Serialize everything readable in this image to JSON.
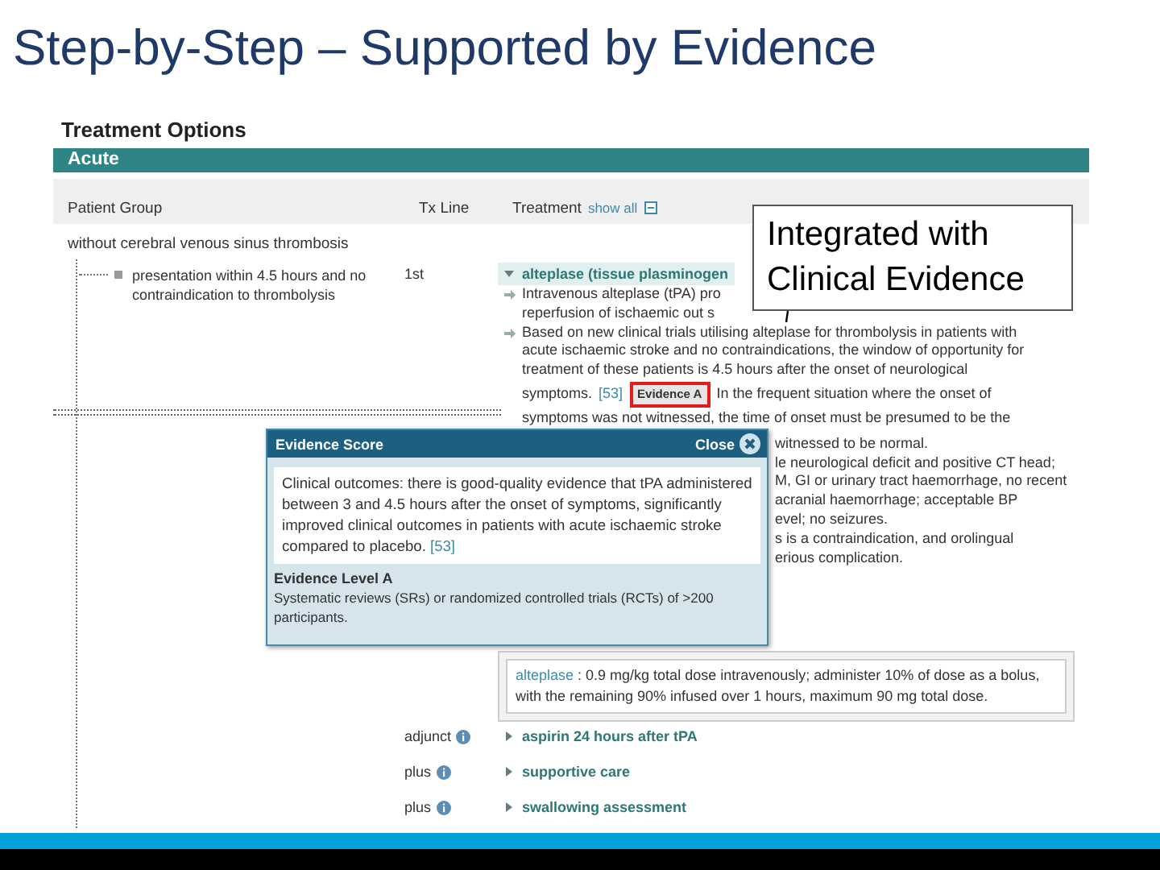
{
  "slide_title": "Step-by-Step – Supported by Evidence",
  "callout": "Integrated with Clinical Evidence",
  "panel": {
    "title": "Treatment Options",
    "section": "Acute",
    "columns": [
      "Patient Group",
      "Tx Line",
      "Treatment"
    ],
    "show_all": "show all",
    "group": "without cerebral venous sinus thrombosis",
    "subgroup": "presentation within 4.5 hours and no contraindication to thrombolysis",
    "treatments": [
      {
        "tx_line": "1st",
        "info": false,
        "name": "alteplase (tissue plasminogen",
        "expanded": true,
        "bullets": [
          {
            "lines": [
              "Intravenous alteplase (tPA) pro",
              "reperfusion of ischaemic out s"
            ]
          },
          {
            "lines": [
              "Based on new clinical trials utilising alteplase for thrombolysis in patients with",
              "acute ischaemic stroke and no contraindications, the window of opportunity for",
              "treatment of these patients is 4.5 hours after the onset of neurological"
            ],
            "before": "symptoms.",
            "reference": "[53]",
            "badge": "Evidence A",
            "after": "In the frequent situation where the onset of",
            "after_lines": [
              "symptoms was not witnessed, the time of onset must be presumed to be the"
            ]
          }
        ],
        "covered_lines": [
          "witnessed to be normal.",
          "le neurological deficit and positive CT head;",
          "M, GI or urinary tract haemorrhage, no recent",
          "acranial haemorrhage; acceptable BP",
          "evel; no seizures.",
          "s is a contraindication, and orolingual",
          "erious complication."
        ],
        "dosing": {
          "drug": "alteplase",
          "text": " : 0.9 mg/kg total dose intravenously; administer 10% of dose as a bolus, with the remaining 90% infused over 1 hours, maximum 90 mg total dose."
        }
      },
      {
        "tx_line": "adjunct",
        "info": true,
        "name": "aspirin 24 hours after tPA",
        "expanded": false
      },
      {
        "tx_line": "plus",
        "info": true,
        "name": "supportive care",
        "expanded": false
      },
      {
        "tx_line": "plus",
        "info": true,
        "name": "swallowing assessment",
        "expanded": false
      }
    ]
  },
  "popup": {
    "title": "Evidence Score",
    "close": "Close",
    "body": "Clinical outcomes: there is good-quality evidence that tPA administered between 3 and 4.5 hours after the onset of symptoms, significantly improved clinical outcomes in patients with acute ischaemic stroke compared to placebo.",
    "reference": "[53]",
    "level": "Evidence Level A",
    "level_text": "Systematic reviews (SRs) or randomized controlled trials (RCTs) of >200 participants."
  }
}
